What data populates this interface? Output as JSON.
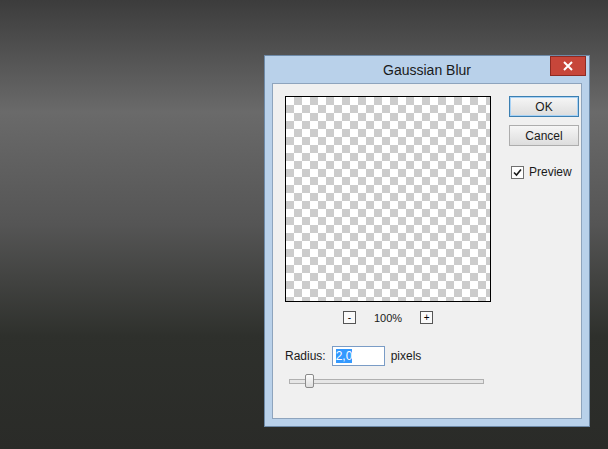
{
  "window": {
    "title": "Gaussian Blur"
  },
  "preview": {
    "zoom": "100%",
    "zoom_out": "-",
    "zoom_in": "+"
  },
  "radius": {
    "label": "Radius:",
    "value": "2,0",
    "unit": "pixels",
    "selected": true,
    "level": 0.1
  },
  "buttons": [
    {
      "label": "OK",
      "default": true
    },
    {
      "label": "Cancel",
      "default": false
    }
  ],
  "checkbox": {
    "label": "Preview",
    "checked": true
  }
}
